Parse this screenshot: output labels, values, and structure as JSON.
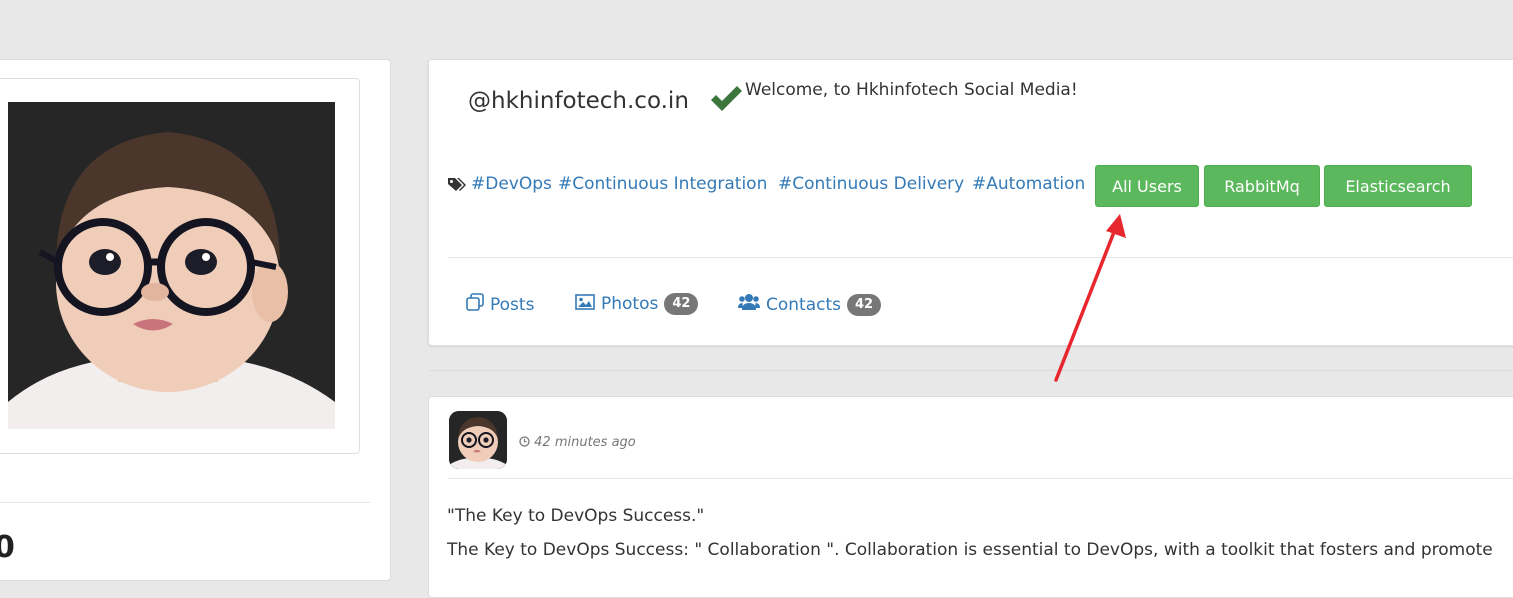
{
  "profile": {
    "handle": "@hkhinfotech.co.in",
    "welcome": "Welcome, to Hkhinfotech Social Media!",
    "tags": [
      "#DevOps",
      "#Continuous Integration",
      "#Continuous Delivery",
      "#Automation"
    ],
    "buttons": {
      "all_users": "All Users",
      "rabbitmq": "RabbitMq",
      "elasticsearch": "Elasticsearch"
    },
    "nav": {
      "posts": "Posts",
      "photos": "Photos",
      "photos_count": "42",
      "contacts": "Contacts",
      "contacts_count": "42"
    }
  },
  "left": {
    "clipped_text": "0"
  },
  "post": {
    "time": "42 minutes ago",
    "title": "\"The Key to DevOps Success.\"",
    "body_partial": "The Key to DevOps Success: \" Collaboration \". Collaboration is essential to DevOps, with a toolkit that fosters and promote"
  },
  "colors": {
    "button": "#5cb85c",
    "link": "#337ab7",
    "badge": "#777777",
    "check": "#3c763d",
    "annotation_arrow": "#e8262d"
  },
  "icons": {
    "verified": "check-icon",
    "tags": "tags-icon",
    "posts": "clone-icon",
    "photos": "image-icon",
    "contacts": "users-icon",
    "time": "clock-icon"
  }
}
